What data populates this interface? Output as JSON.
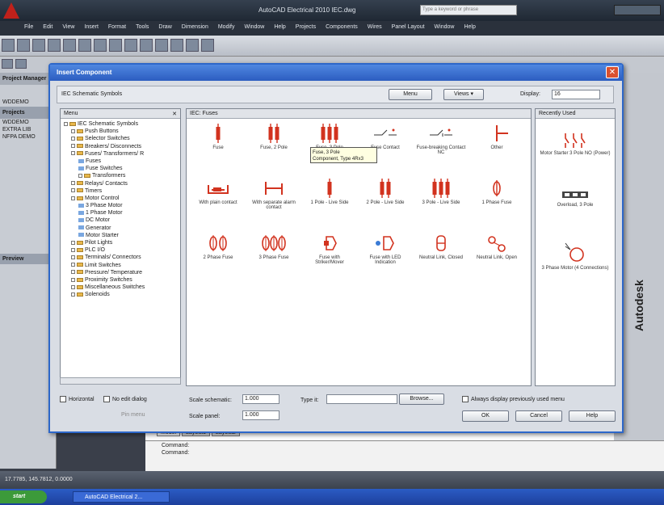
{
  "app": {
    "title": "AutoCAD Electrical 2010   IEC.dwg",
    "search_placeholder": "Type a keyword or phrase",
    "menu": [
      "File",
      "Edit",
      "View",
      "Insert",
      "Format",
      "Tools",
      "Draw",
      "Dimension",
      "Modify",
      "Window",
      "Help",
      "Projects",
      "Components",
      "Wires",
      "Panel Layout",
      "Window",
      "Help"
    ],
    "left_panel": {
      "title": "Project Manager",
      "label": "WDDEMO",
      "section": "Projects",
      "items": [
        "WDDEMO",
        "EXTRA LIB",
        "NFPA DEMO"
      ],
      "preview": "Preview"
    },
    "layout_tabs": [
      "Model",
      "Layout1",
      "Layout2"
    ],
    "command_lines": [
      "Command:",
      "Command:"
    ],
    "status_coords": "17.7785, 145.7812, 0.0000",
    "logo": "Autodesk",
    "taskbar": {
      "start": "start",
      "task": "AutoCAD Electrical 2..."
    }
  },
  "dialog": {
    "title": "Insert Component",
    "subtitle": "IEC Schematic Symbols",
    "menu_button": "Menu",
    "views_button": "Views",
    "display_label": "Display:",
    "display_value": "16",
    "menu_pane_title": "Menu",
    "tree": [
      {
        "label": "IEC Schematic Symbols",
        "level": 0,
        "type": "folder"
      },
      {
        "label": "Push Buttons",
        "level": 1,
        "type": "folder"
      },
      {
        "label": "Selector Switches",
        "level": 1,
        "type": "folder"
      },
      {
        "label": "Breakers/ Disconnects",
        "level": 1,
        "type": "folder"
      },
      {
        "label": "Fuses/ Transformers/ R",
        "level": 1,
        "type": "folder"
      },
      {
        "label": "Fuses",
        "level": 2,
        "type": "item"
      },
      {
        "label": "Fuse Switches",
        "level": 2,
        "type": "item"
      },
      {
        "label": "Transformers",
        "level": 2,
        "type": "folder"
      },
      {
        "label": "Relays/ Contacts",
        "level": 1,
        "type": "folder"
      },
      {
        "label": "Timers",
        "level": 1,
        "type": "folder"
      },
      {
        "label": "Motor Control",
        "level": 1,
        "type": "folder"
      },
      {
        "label": "3 Phase Motor",
        "level": 2,
        "type": "item"
      },
      {
        "label": "1 Phase Motor",
        "level": 2,
        "type": "item"
      },
      {
        "label": "DC Motor",
        "level": 2,
        "type": "item"
      },
      {
        "label": "Generator",
        "level": 2,
        "type": "item"
      },
      {
        "label": "Motor Starter",
        "level": 2,
        "type": "item"
      },
      {
        "label": "Pilot Lights",
        "level": 1,
        "type": "folder"
      },
      {
        "label": "PLC I/O",
        "level": 1,
        "type": "folder"
      },
      {
        "label": "Terminals/ Connectors",
        "level": 1,
        "type": "folder"
      },
      {
        "label": "Limit Switches",
        "level": 1,
        "type": "folder"
      },
      {
        "label": "Pressure/ Temperature",
        "level": 1,
        "type": "folder"
      },
      {
        "label": "Proximity Switches",
        "level": 1,
        "type": "folder"
      },
      {
        "label": "Miscellaneous Switches",
        "level": 1,
        "type": "folder"
      },
      {
        "label": "Solenoids",
        "level": 1,
        "type": "folder"
      }
    ],
    "center_title": "IEC: Fuses",
    "symbols": [
      {
        "label": "Fuse",
        "kind": "fuse1"
      },
      {
        "label": "Fuse, 2 Pole",
        "kind": "fuse2"
      },
      {
        "label": "Fuse, 3 Pole",
        "kind": "fuse3"
      },
      {
        "label": "Fuse Contact",
        "kind": "contact"
      },
      {
        "label": "Fuse-breaking Contact NC",
        "kind": "contactnc"
      },
      {
        "label": "Other",
        "kind": "other"
      },
      {
        "label": "With plain contact",
        "kind": "plain"
      },
      {
        "label": "With separate alarm contact",
        "kind": "alarm"
      },
      {
        "label": "1 Pole - Live Side",
        "kind": "fuse1"
      },
      {
        "label": "2 Pole - Live Side",
        "kind": "fuse2"
      },
      {
        "label": "3 Pole - Live Side",
        "kind": "fuse3"
      },
      {
        "label": "1 Phase Fuse",
        "kind": "phase1"
      },
      {
        "label": "2 Phase Fuse",
        "kind": "phase2"
      },
      {
        "label": "3 Phase Fuse",
        "kind": "phase3"
      },
      {
        "label": "Fuse with Striker/Mover",
        "kind": "striker"
      },
      {
        "label": "Fuse with LED Indication",
        "kind": "led"
      },
      {
        "label": "Neutral Link, Closed",
        "kind": "neutral"
      },
      {
        "label": "Neutral Link, Open",
        "kind": "neutralopen"
      }
    ],
    "tooltip": [
      "Fuse, 3 Pole",
      "Component, Type 4Rx3"
    ],
    "recent_title": "Recently Used",
    "recent": [
      {
        "label": "Motor Starter 3 Pole NO (Power)"
      },
      {
        "label": "Overload, 3 Pole"
      },
      {
        "label": "3 Phase Motor (4 Connections)"
      }
    ],
    "footer": {
      "horizontal": "Horizontal",
      "no_edit": "No edit dialog",
      "pin_menu": "Pin menu",
      "scale_schematic_label": "Scale schematic:",
      "scale_schematic_value": "1.000",
      "scale_panel_label": "Scale panel:",
      "scale_panel_value": "1.000",
      "type_it_label": "Type it:",
      "type_it_value": "",
      "browse": "Browse...",
      "always_display": "Always display previously used menu",
      "ok": "OK",
      "cancel": "Cancel",
      "help": "Help"
    }
  },
  "colors": {
    "symbol": "#d2331f",
    "dialog_title": "#2c5dc0",
    "accent": "#2d67c9"
  }
}
